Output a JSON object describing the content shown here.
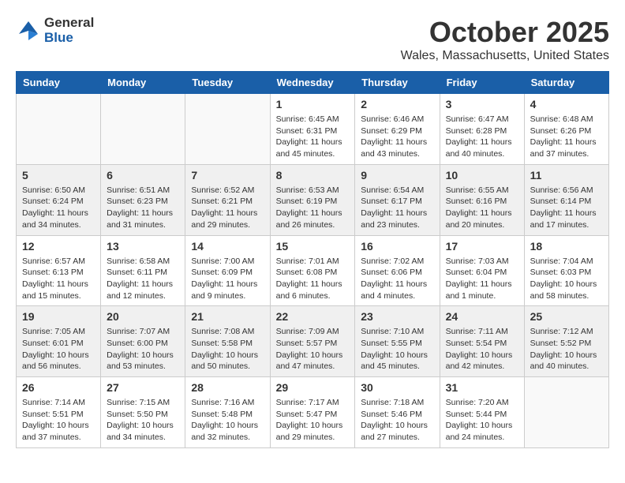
{
  "header": {
    "logo_general": "General",
    "logo_blue": "Blue",
    "month": "October 2025",
    "location": "Wales, Massachusetts, United States"
  },
  "days_of_week": [
    "Sunday",
    "Monday",
    "Tuesday",
    "Wednesday",
    "Thursday",
    "Friday",
    "Saturday"
  ],
  "weeks": [
    {
      "shaded": false,
      "days": [
        {
          "num": "",
          "info": ""
        },
        {
          "num": "",
          "info": ""
        },
        {
          "num": "",
          "info": ""
        },
        {
          "num": "1",
          "info": "Sunrise: 6:45 AM\nSunset: 6:31 PM\nDaylight: 11 hours\nand 45 minutes."
        },
        {
          "num": "2",
          "info": "Sunrise: 6:46 AM\nSunset: 6:29 PM\nDaylight: 11 hours\nand 43 minutes."
        },
        {
          "num": "3",
          "info": "Sunrise: 6:47 AM\nSunset: 6:28 PM\nDaylight: 11 hours\nand 40 minutes."
        },
        {
          "num": "4",
          "info": "Sunrise: 6:48 AM\nSunset: 6:26 PM\nDaylight: 11 hours\nand 37 minutes."
        }
      ]
    },
    {
      "shaded": true,
      "days": [
        {
          "num": "5",
          "info": "Sunrise: 6:50 AM\nSunset: 6:24 PM\nDaylight: 11 hours\nand 34 minutes."
        },
        {
          "num": "6",
          "info": "Sunrise: 6:51 AM\nSunset: 6:23 PM\nDaylight: 11 hours\nand 31 minutes."
        },
        {
          "num": "7",
          "info": "Sunrise: 6:52 AM\nSunset: 6:21 PM\nDaylight: 11 hours\nand 29 minutes."
        },
        {
          "num": "8",
          "info": "Sunrise: 6:53 AM\nSunset: 6:19 PM\nDaylight: 11 hours\nand 26 minutes."
        },
        {
          "num": "9",
          "info": "Sunrise: 6:54 AM\nSunset: 6:17 PM\nDaylight: 11 hours\nand 23 minutes."
        },
        {
          "num": "10",
          "info": "Sunrise: 6:55 AM\nSunset: 6:16 PM\nDaylight: 11 hours\nand 20 minutes."
        },
        {
          "num": "11",
          "info": "Sunrise: 6:56 AM\nSunset: 6:14 PM\nDaylight: 11 hours\nand 17 minutes."
        }
      ]
    },
    {
      "shaded": false,
      "days": [
        {
          "num": "12",
          "info": "Sunrise: 6:57 AM\nSunset: 6:13 PM\nDaylight: 11 hours\nand 15 minutes."
        },
        {
          "num": "13",
          "info": "Sunrise: 6:58 AM\nSunset: 6:11 PM\nDaylight: 11 hours\nand 12 minutes."
        },
        {
          "num": "14",
          "info": "Sunrise: 7:00 AM\nSunset: 6:09 PM\nDaylight: 11 hours\nand 9 minutes."
        },
        {
          "num": "15",
          "info": "Sunrise: 7:01 AM\nSunset: 6:08 PM\nDaylight: 11 hours\nand 6 minutes."
        },
        {
          "num": "16",
          "info": "Sunrise: 7:02 AM\nSunset: 6:06 PM\nDaylight: 11 hours\nand 4 minutes."
        },
        {
          "num": "17",
          "info": "Sunrise: 7:03 AM\nSunset: 6:04 PM\nDaylight: 11 hours\nand 1 minute."
        },
        {
          "num": "18",
          "info": "Sunrise: 7:04 AM\nSunset: 6:03 PM\nDaylight: 10 hours\nand 58 minutes."
        }
      ]
    },
    {
      "shaded": true,
      "days": [
        {
          "num": "19",
          "info": "Sunrise: 7:05 AM\nSunset: 6:01 PM\nDaylight: 10 hours\nand 56 minutes."
        },
        {
          "num": "20",
          "info": "Sunrise: 7:07 AM\nSunset: 6:00 PM\nDaylight: 10 hours\nand 53 minutes."
        },
        {
          "num": "21",
          "info": "Sunrise: 7:08 AM\nSunset: 5:58 PM\nDaylight: 10 hours\nand 50 minutes."
        },
        {
          "num": "22",
          "info": "Sunrise: 7:09 AM\nSunset: 5:57 PM\nDaylight: 10 hours\nand 47 minutes."
        },
        {
          "num": "23",
          "info": "Sunrise: 7:10 AM\nSunset: 5:55 PM\nDaylight: 10 hours\nand 45 minutes."
        },
        {
          "num": "24",
          "info": "Sunrise: 7:11 AM\nSunset: 5:54 PM\nDaylight: 10 hours\nand 42 minutes."
        },
        {
          "num": "25",
          "info": "Sunrise: 7:12 AM\nSunset: 5:52 PM\nDaylight: 10 hours\nand 40 minutes."
        }
      ]
    },
    {
      "shaded": false,
      "days": [
        {
          "num": "26",
          "info": "Sunrise: 7:14 AM\nSunset: 5:51 PM\nDaylight: 10 hours\nand 37 minutes."
        },
        {
          "num": "27",
          "info": "Sunrise: 7:15 AM\nSunset: 5:50 PM\nDaylight: 10 hours\nand 34 minutes."
        },
        {
          "num": "28",
          "info": "Sunrise: 7:16 AM\nSunset: 5:48 PM\nDaylight: 10 hours\nand 32 minutes."
        },
        {
          "num": "29",
          "info": "Sunrise: 7:17 AM\nSunset: 5:47 PM\nDaylight: 10 hours\nand 29 minutes."
        },
        {
          "num": "30",
          "info": "Sunrise: 7:18 AM\nSunset: 5:46 PM\nDaylight: 10 hours\nand 27 minutes."
        },
        {
          "num": "31",
          "info": "Sunrise: 7:20 AM\nSunset: 5:44 PM\nDaylight: 10 hours\nand 24 minutes."
        },
        {
          "num": "",
          "info": ""
        }
      ]
    }
  ]
}
